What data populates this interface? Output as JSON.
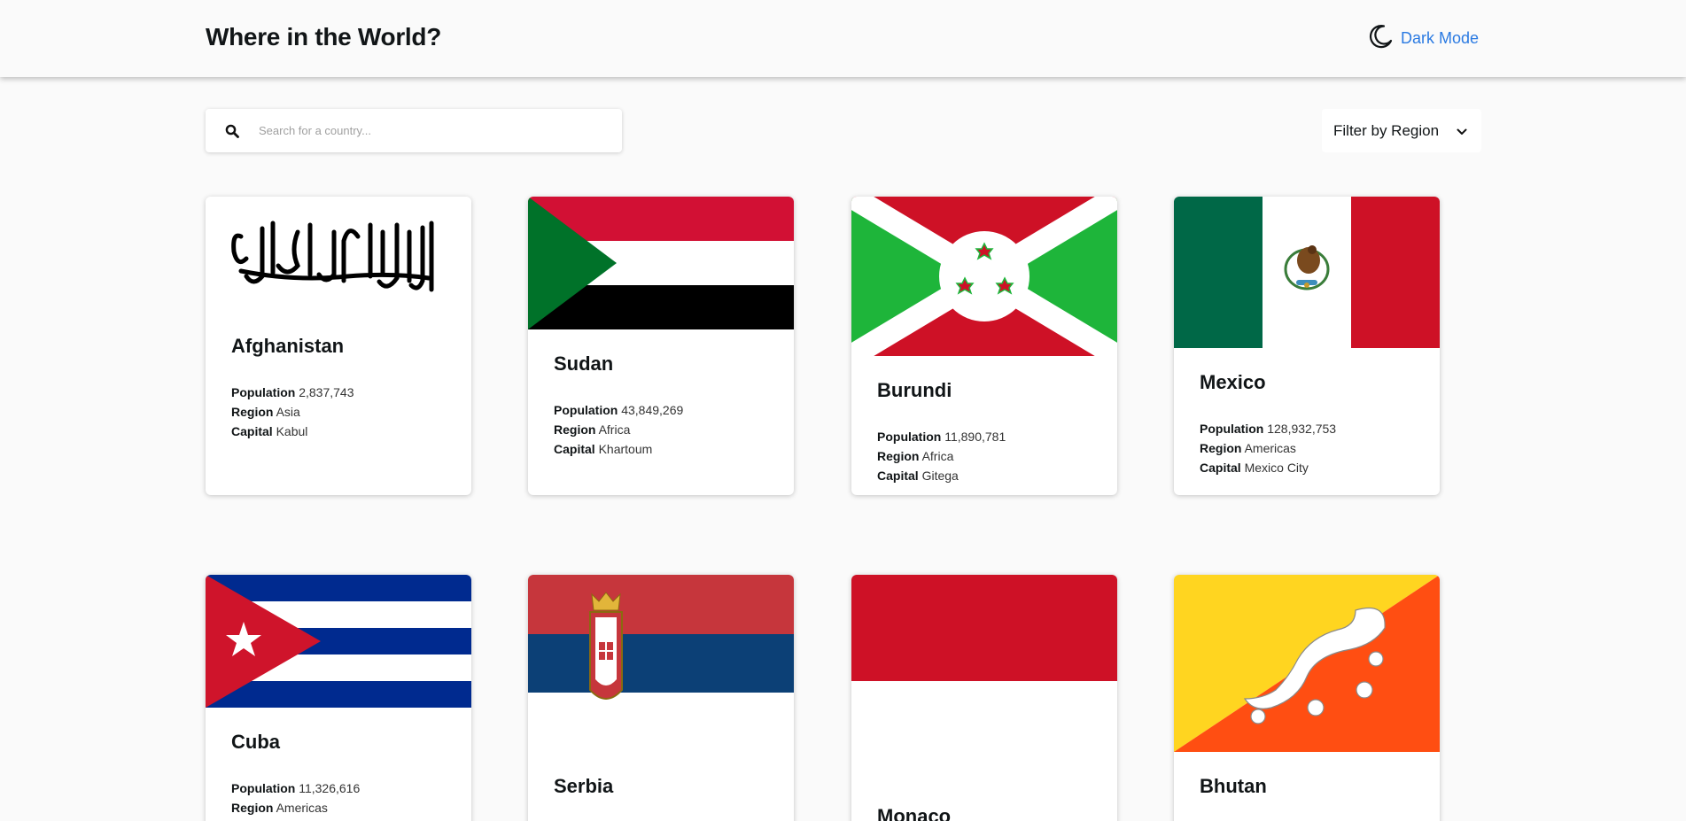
{
  "header": {
    "title": "Where in the World?",
    "theme_toggle_label": "Dark Mode"
  },
  "search": {
    "placeholder": "Search for a country...",
    "value": ""
  },
  "filter": {
    "label": "Filter by Region"
  },
  "labels": {
    "population": "Population",
    "region": "Region",
    "capital": "Capital"
  },
  "cards": [
    {
      "name": "Afghanistan",
      "population": "2,837,743",
      "region": "Asia",
      "capital": "Kabul"
    },
    {
      "name": "Sudan",
      "population": "43,849,269",
      "region": "Africa",
      "capital": "Khartoum"
    },
    {
      "name": "Burundi",
      "population": "11,890,781",
      "region": "Africa",
      "capital": "Gitega"
    },
    {
      "name": "Mexico",
      "population": "128,932,753",
      "region": "Americas",
      "capital": "Mexico City"
    },
    {
      "name": "Cuba",
      "population": "11,326,616",
      "region": "Americas",
      "capital": ""
    },
    {
      "name": "Serbia",
      "population": "",
      "region": "",
      "capital": ""
    },
    {
      "name": "Monaco",
      "population": "",
      "region": "",
      "capital": ""
    },
    {
      "name": "Bhutan",
      "population": "",
      "region": "",
      "capital": ""
    }
  ],
  "colors": {
    "accent": "#2a7ae2",
    "background": "#fafafa"
  }
}
